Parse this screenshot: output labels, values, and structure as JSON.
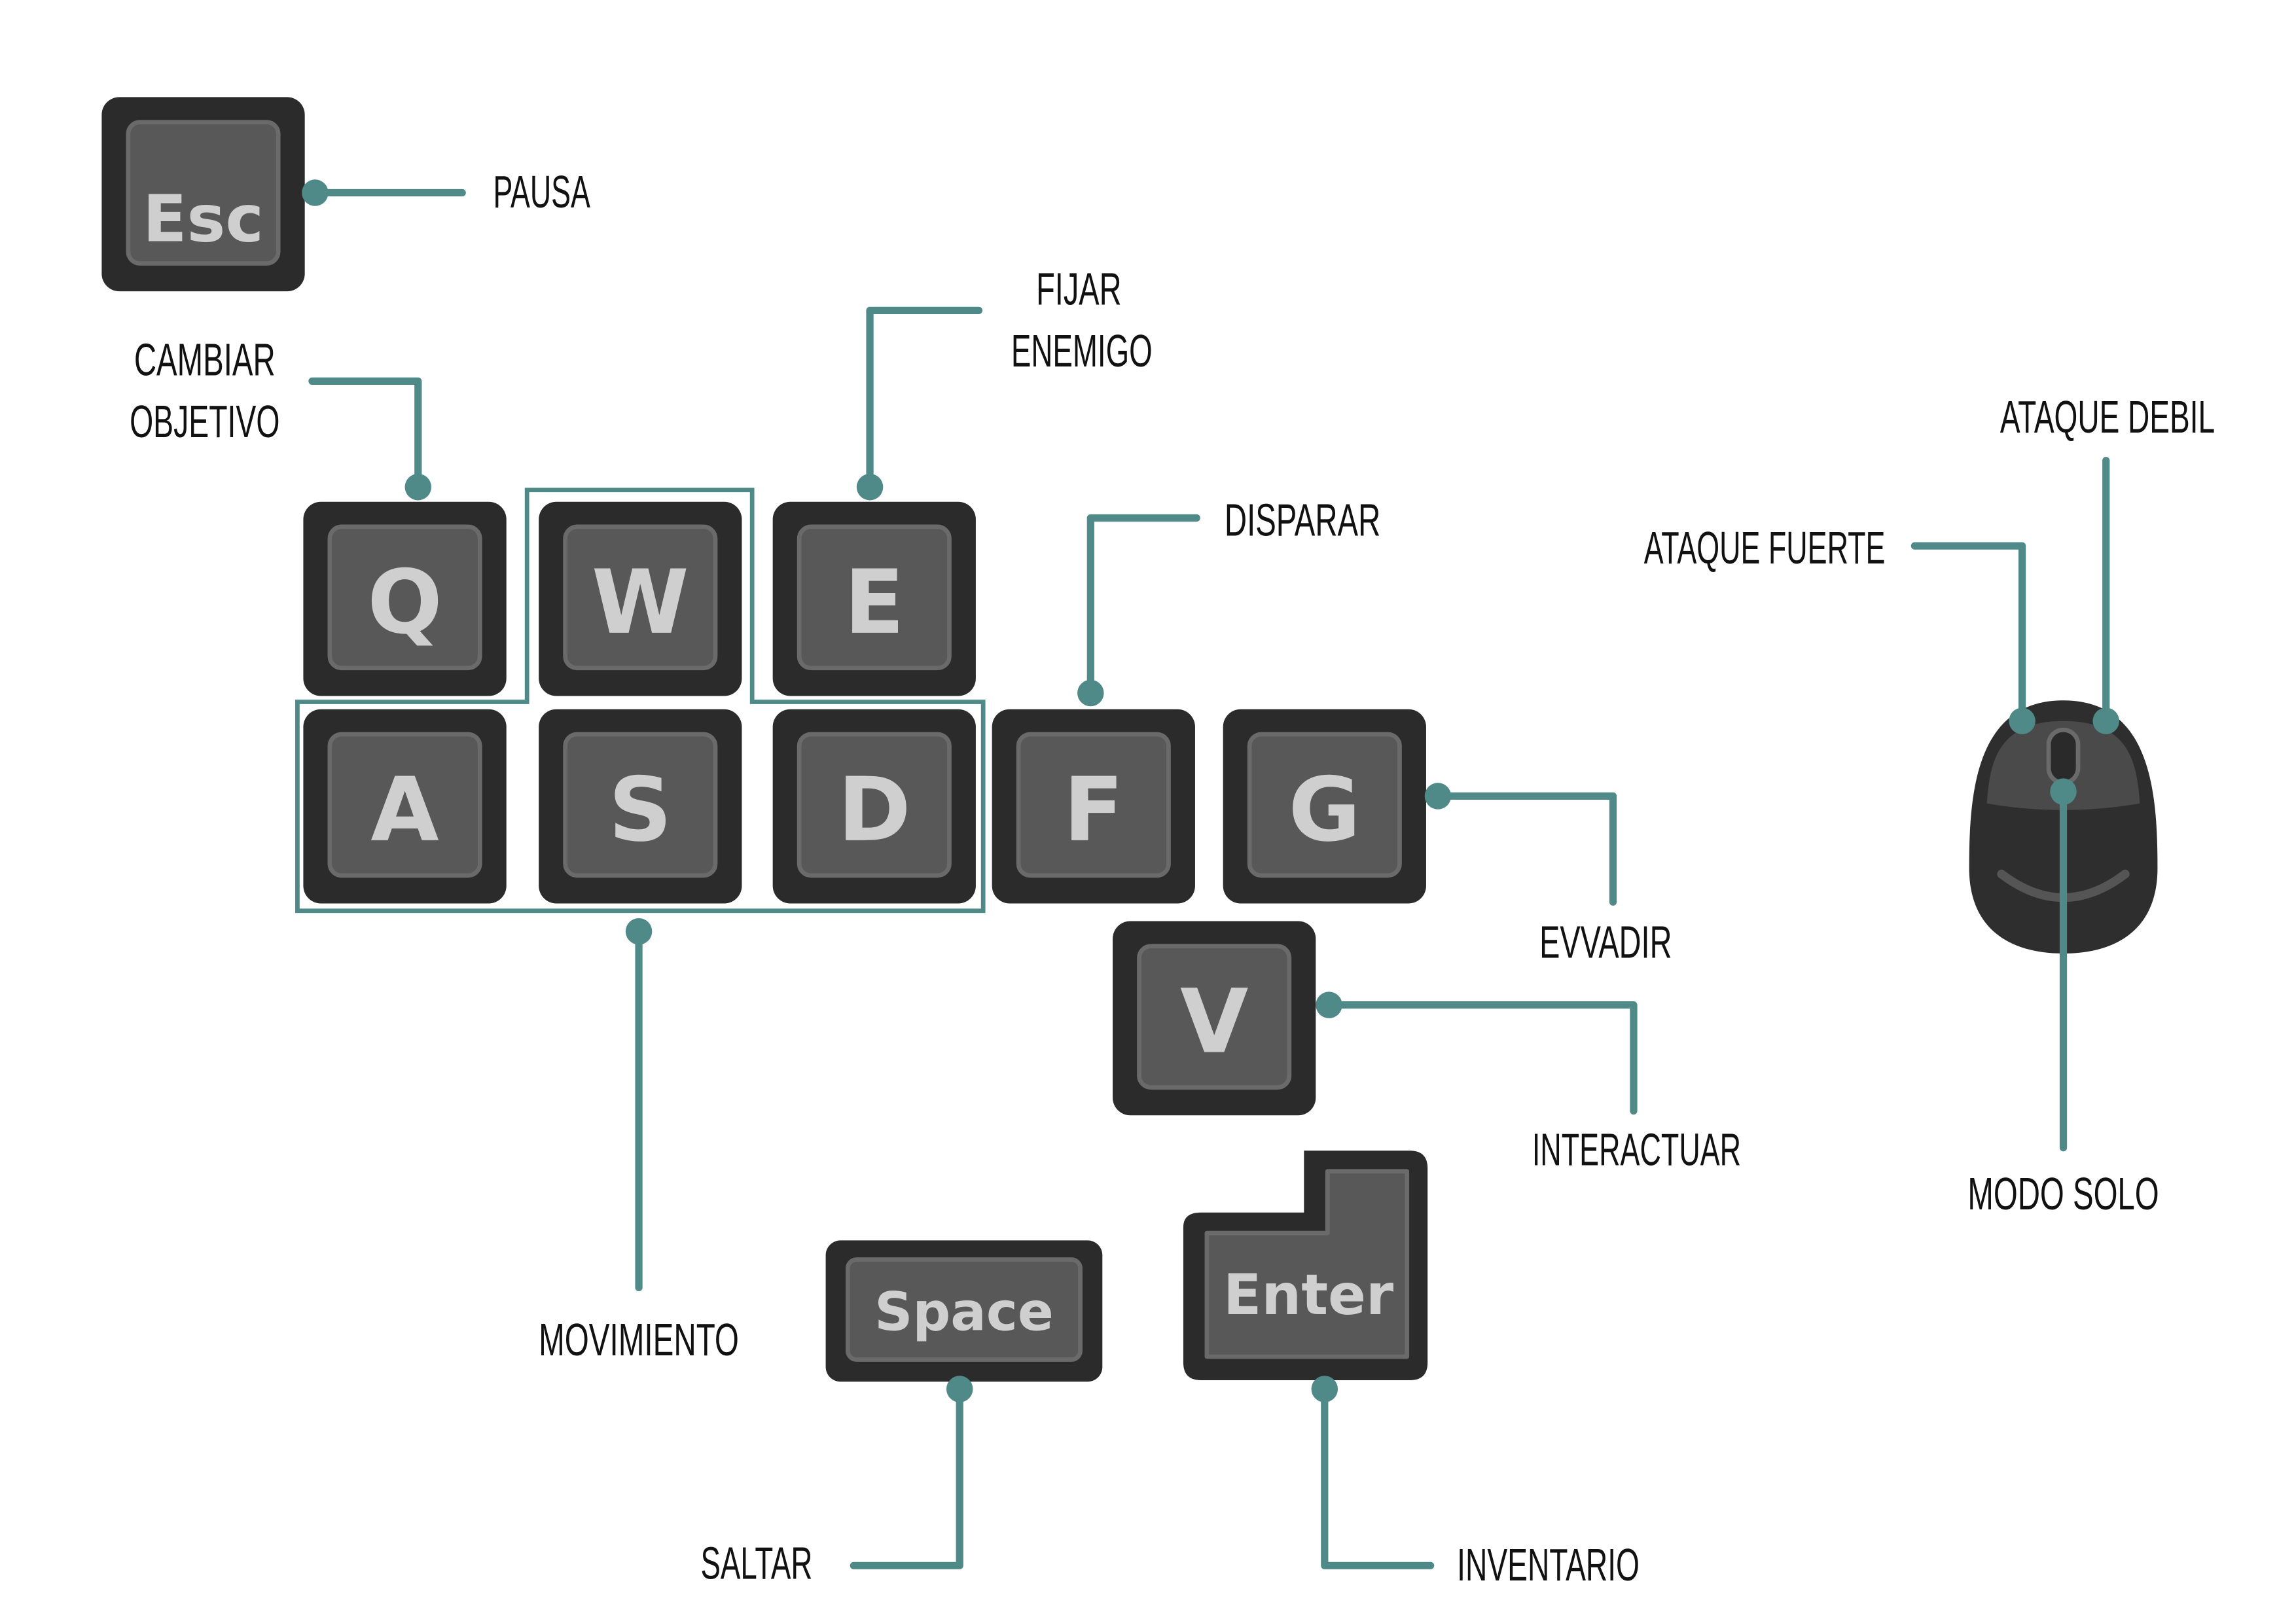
{
  "colors": {
    "connector": "#4f8a88",
    "key_outer": "#2b2b2b",
    "key_inner": "#585858",
    "key_text": "#d2d2d2",
    "label_text": "#111111",
    "mouse_body": "#2e2e2e"
  },
  "keys": {
    "esc": "Esc",
    "q": "Q",
    "w": "W",
    "e": "E",
    "a": "A",
    "s": "S",
    "d": "D",
    "f": "F",
    "g": "G",
    "v": "V",
    "space": "Space",
    "enter": "Enter"
  },
  "labels": {
    "pausa": "PAUSA",
    "cambiar_objetivo": [
      "CAMBIAR",
      "OBJETIVO"
    ],
    "fijar_enemigo": [
      "FIJAR",
      "ENEMIGO"
    ],
    "disparar": "DISPARAR",
    "evvadir": "EVVADIR",
    "interactuar": "INTERACTUAR",
    "movimiento": "MOVIMIENTO",
    "saltar": "SALTAR",
    "inventario": "INVENTARIO",
    "ataque_debil": "ATAQUE DEBIL",
    "ataque_fuerte": "ATAQUE FUERTE",
    "modo_solo": "MODO SOLO"
  },
  "icons": {
    "mouse": "computer-mouse-icon"
  }
}
